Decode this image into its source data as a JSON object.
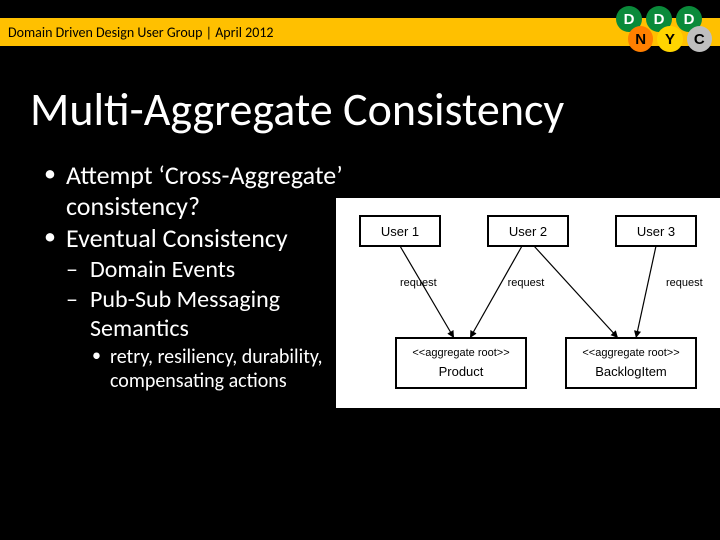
{
  "header": {
    "group_line": "Domain Driven Design User Group | April 2012"
  },
  "logo": {
    "r1": [
      "D",
      "D",
      "D"
    ],
    "r2": [
      "N",
      "Y",
      "C"
    ]
  },
  "title": "Multi-Aggregate Consistency",
  "bullets": {
    "b1": "Attempt ‘Cross-Aggregate’ consistency?",
    "b2": "Eventual Consistency",
    "b2_1": "Domain Events",
    "b2_2": "Pub-Sub Messaging Semantics",
    "b2_2_1": "retry, resiliency, durability, compensating actions"
  },
  "diagram": {
    "users": [
      "User 1",
      "User 2",
      "User 3"
    ],
    "req_label": "request",
    "agg_label": "<<aggregate root>>",
    "agg1": "Product",
    "agg2": "BacklogItem"
  }
}
